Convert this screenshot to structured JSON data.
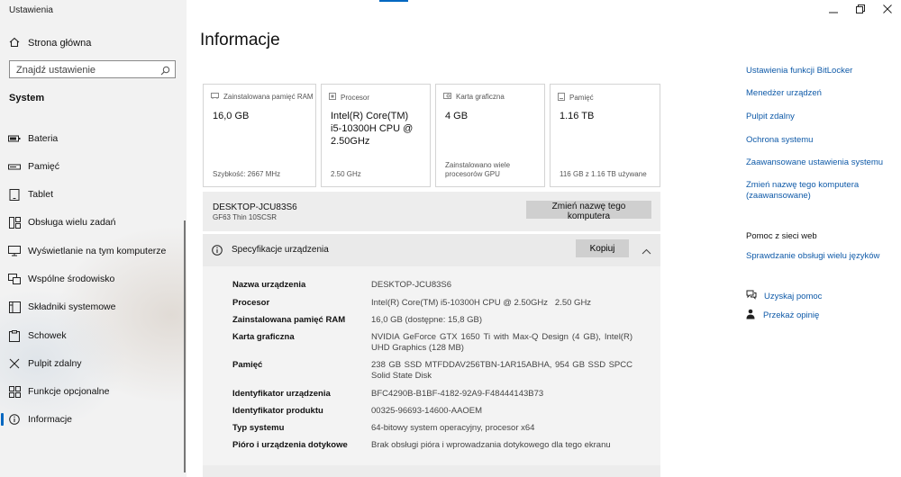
{
  "window": {
    "title": "Ustawienia"
  },
  "sidebar": {
    "home_label": "Strona główna",
    "search_placeholder": "Znajdź ustawienie",
    "section_title": "System",
    "items": [
      {
        "label": "Bateria",
        "icon": "battery-icon"
      },
      {
        "label": "Pamięć",
        "icon": "storage-icon"
      },
      {
        "label": "Tablet",
        "icon": "tablet-icon"
      },
      {
        "label": "Obsługa wielu zadań",
        "icon": "multitasking-icon"
      },
      {
        "label": "Wyświetlanie na tym komputerze",
        "icon": "projecting-icon"
      },
      {
        "label": "Wspólne środowisko",
        "icon": "shared-experiences-icon"
      },
      {
        "label": "Składniki systemowe",
        "icon": "system-components-icon"
      },
      {
        "label": "Schowek",
        "icon": "clipboard-icon"
      },
      {
        "label": "Pulpit zdalny",
        "icon": "remote-desktop-icon"
      },
      {
        "label": "Funkcje opcjonalne",
        "icon": "optional-features-icon"
      },
      {
        "label": "Informacje",
        "icon": "info-icon",
        "active": true
      }
    ]
  },
  "main": {
    "title": "Informacje",
    "cards": [
      {
        "label": "Zainstalowana pamięć RAM",
        "value": "16,0 GB",
        "sub": "Szybkość: 2667 MHz",
        "icon": "ram-icon"
      },
      {
        "label": "Procesor",
        "value": "Intel(R) Core(TM)\ni5-10300H CPU @\n2.50GHz",
        "sub": "2.50 GHz",
        "icon": "cpu-icon"
      },
      {
        "label": "Karta graficzna",
        "value": "4 GB",
        "sub": "Zainstalowano wiele\nprocesorów GPU",
        "icon": "gpu-icon"
      },
      {
        "label": "Pamięć",
        "value": "1.16 TB",
        "sub": "116 GB z 1.16 TB używane",
        "icon": "disk-icon"
      }
    ],
    "pc": {
      "name": "DESKTOP-JCU83S6",
      "model": "GF63 Thin 10SCSR",
      "rename_label": "Zmień nazwę tego komputera"
    },
    "specs": {
      "title": "Specyfikacje urządzenia",
      "copy_label": "Kopiuj",
      "rows": [
        {
          "label": "Nazwa urządzenia",
          "value": "DESKTOP-JCU83S6"
        },
        {
          "label": "Procesor",
          "value": "Intel(R) Core(TM) i5-10300H CPU @ 2.50GHz   2.50 GHz"
        },
        {
          "label": "Zainstalowana pamięć RAM",
          "value": "16,0 GB (dostępne: 15,8 GB)"
        },
        {
          "label": "Karta graficzna",
          "value": "NVIDIA GeForce GTX 1650 Ti with Max-Q Design (4 GB), Intel(R) UHD Graphics (128 MB)"
        },
        {
          "label": "Pamięć",
          "value": "238 GB SSD MTFDDAV256TBN-1AR15ABHA, 954 GB SSD SPCC Solid State Disk"
        },
        {
          "label": "Identyfikator urządzenia",
          "value": "BFC4290B-B1BF-4182-92A9-F48444143B73"
        },
        {
          "label": "Identyfikator produktu",
          "value": "00325-96693-14600-AAOEM"
        },
        {
          "label": "Typ systemu",
          "value": "64-bitowy system operacyjny, procesor x64"
        },
        {
          "label": "Pióro i urządzenia dotykowe",
          "value": "Brak obsługi pióra i wprowadzania dotykowego dla tego ekranu"
        }
      ]
    }
  },
  "right": {
    "links": [
      "Ustawienia funkcji BitLocker",
      "Menedżer urządzeń",
      "Pulpit zdalny",
      "Ochrona systemu",
      "Zaawansowane ustawienia systemu",
      "Zmień nazwę tego komputera (zaawansowane)"
    ],
    "help_heading": "Pomoc z sieci web",
    "help_link": "Sprawdzanie obsługi wielu języków",
    "actions": [
      {
        "label": "Uzyskaj pomoc",
        "icon": "get-help-icon"
      },
      {
        "label": "Przekaż opinię",
        "icon": "feedback-icon"
      }
    ]
  },
  "colors": {
    "accent": "#0067c0",
    "link": "#0f5aa8"
  }
}
